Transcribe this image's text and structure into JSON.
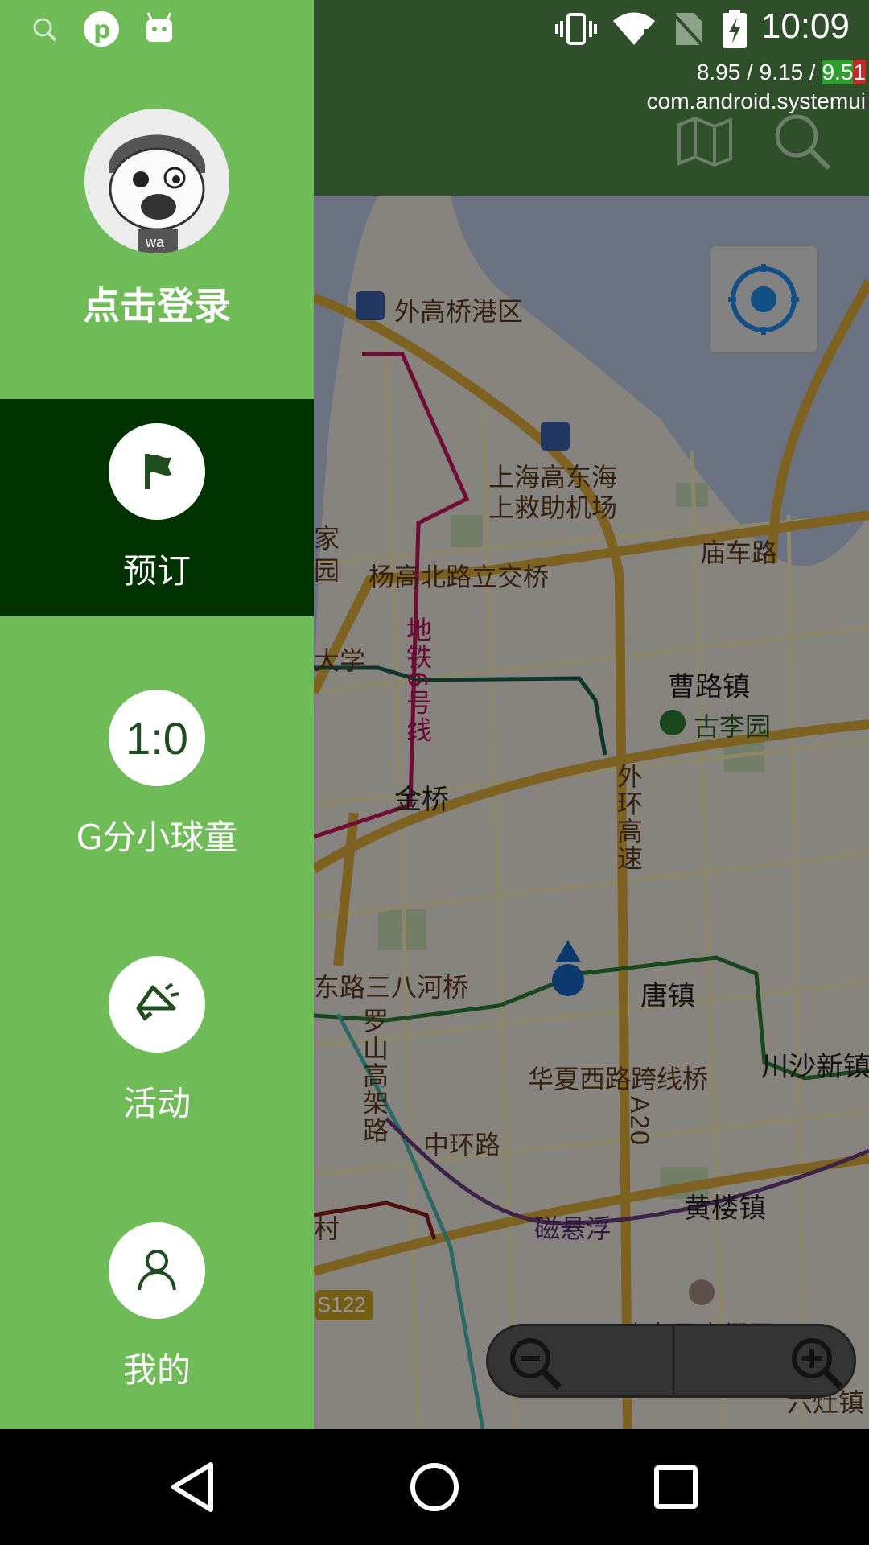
{
  "status_bar": {
    "time": "10:09",
    "left_icons": [
      "search-icon",
      "pinterest-icon",
      "android-icon"
    ],
    "right_icons": [
      "vibrate-icon",
      "wifi-icon",
      "no-sim-icon",
      "battery-charging-icon"
    ]
  },
  "debug_overlay": {
    "line1_a": "8.95 / 9.15 / ",
    "line1_b": "9.5",
    "line1_c": "1",
    "line2": "com.android.systemui"
  },
  "app_bar": {
    "icons": [
      "map-icon",
      "search-icon"
    ]
  },
  "drawer": {
    "login_label": "点击登录",
    "menu": [
      {
        "label": "预订",
        "icon": "flag-icon",
        "active": true
      },
      {
        "label": "G分小球童",
        "icon": "score-icon",
        "icon_text": "1:0",
        "active": false
      },
      {
        "label": "活动",
        "icon": "megaphone-icon",
        "active": false
      },
      {
        "label": "我的",
        "icon": "user-icon",
        "active": false
      }
    ]
  },
  "map": {
    "labels": {
      "waigaoqiao": "外高桥港区",
      "airport_1": "上海高东海",
      "airport_2": "上救助机场",
      "miaolu": "庙车路",
      "jia": "家",
      "yuan": "园",
      "yanggao": "杨高北路立交桥",
      "daxue": "大学",
      "metro": "地铁6号线",
      "caolu": "曹路镇",
      "gulyuan": "古李园",
      "jinqiao": "金桥",
      "waihuan": "外环高速",
      "sanbahe": "东路三八河桥",
      "tangzhen": "唐镇",
      "luoshan": "罗山高架路",
      "huaxia": "华夏西路跨线桥",
      "chuansha": "川沙新镇",
      "zhonghuan": "中环路",
      "a20": "A20",
      "huanglou": "黄楼镇",
      "cun": "村",
      "maglev": "磁悬浮",
      "s122": "S122",
      "disney": "迪士尼度假区",
      "liuzao": "六灶镇"
    }
  },
  "nav_bar": {
    "buttons": [
      "back-icon",
      "home-icon",
      "recents-icon"
    ]
  }
}
